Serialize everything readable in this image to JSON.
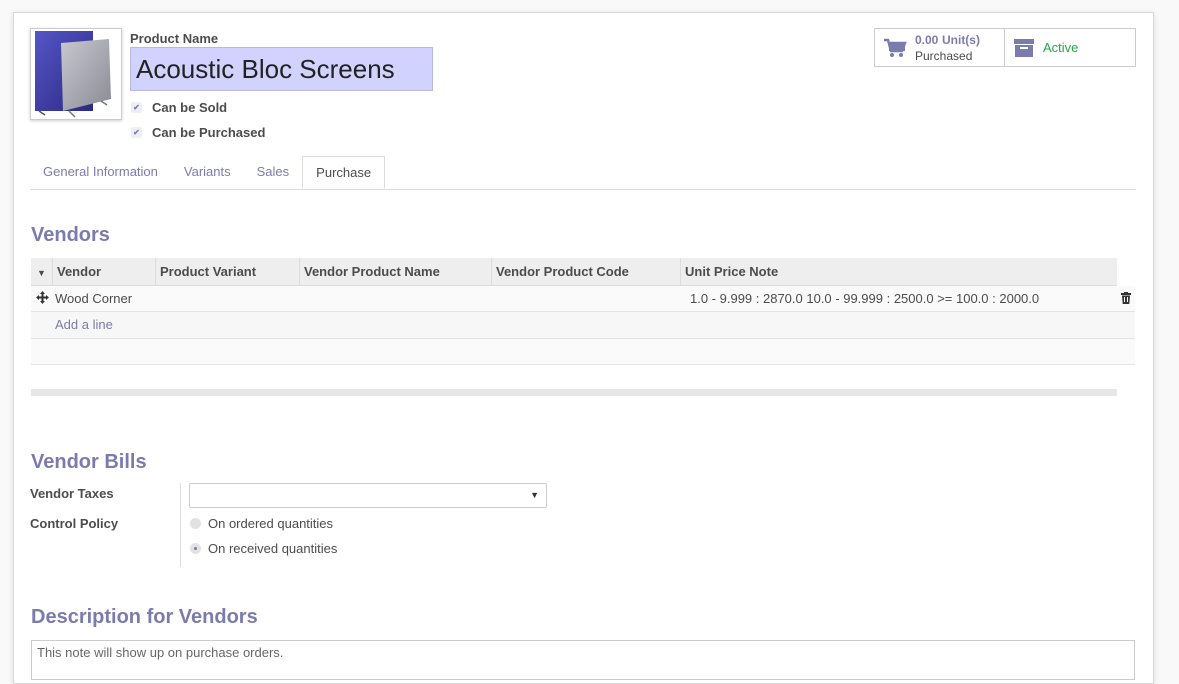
{
  "product": {
    "name_label": "Product Name",
    "name_value": "Acoustic Bloc Screens",
    "can_be_sold": "Can be Sold",
    "can_be_purchased": "Can be Purchased"
  },
  "stats": {
    "purchased_value": "0.00",
    "purchased_unit": "Unit(s)",
    "purchased_label": "Purchased",
    "active_label": "Active"
  },
  "tabs": [
    {
      "label": "General Information"
    },
    {
      "label": "Variants"
    },
    {
      "label": "Sales"
    },
    {
      "label": "Purchase"
    }
  ],
  "vendors": {
    "title": "Vendors",
    "columns": [
      "Vendor",
      "Product Variant",
      "Vendor Product Name",
      "Vendor Product Code",
      "Unit Price Note"
    ],
    "rows": [
      {
        "vendor": "Wood Corner",
        "variant": "",
        "product_name": "",
        "product_code": "",
        "price_note": "1.0 - 9.999 : 2870.0 10.0 - 99.999 : 2500.0 >= 100.0 : 2000.0"
      }
    ],
    "add_line": "Add a line"
  },
  "vendor_bills": {
    "title": "Vendor Bills",
    "taxes_label": "Vendor Taxes",
    "taxes_value": "",
    "control_policy_label": "Control Policy",
    "policy_options": [
      "On ordered quantities",
      "On received quantities"
    ],
    "policy_selected": "On received quantities"
  },
  "description": {
    "title": "Description for Vendors",
    "placeholder": "This note will show up on purchase orders."
  },
  "colors": {
    "accent": "#7c7bad",
    "active": "#28a745",
    "name_field_bg": "#d2d2ff"
  }
}
